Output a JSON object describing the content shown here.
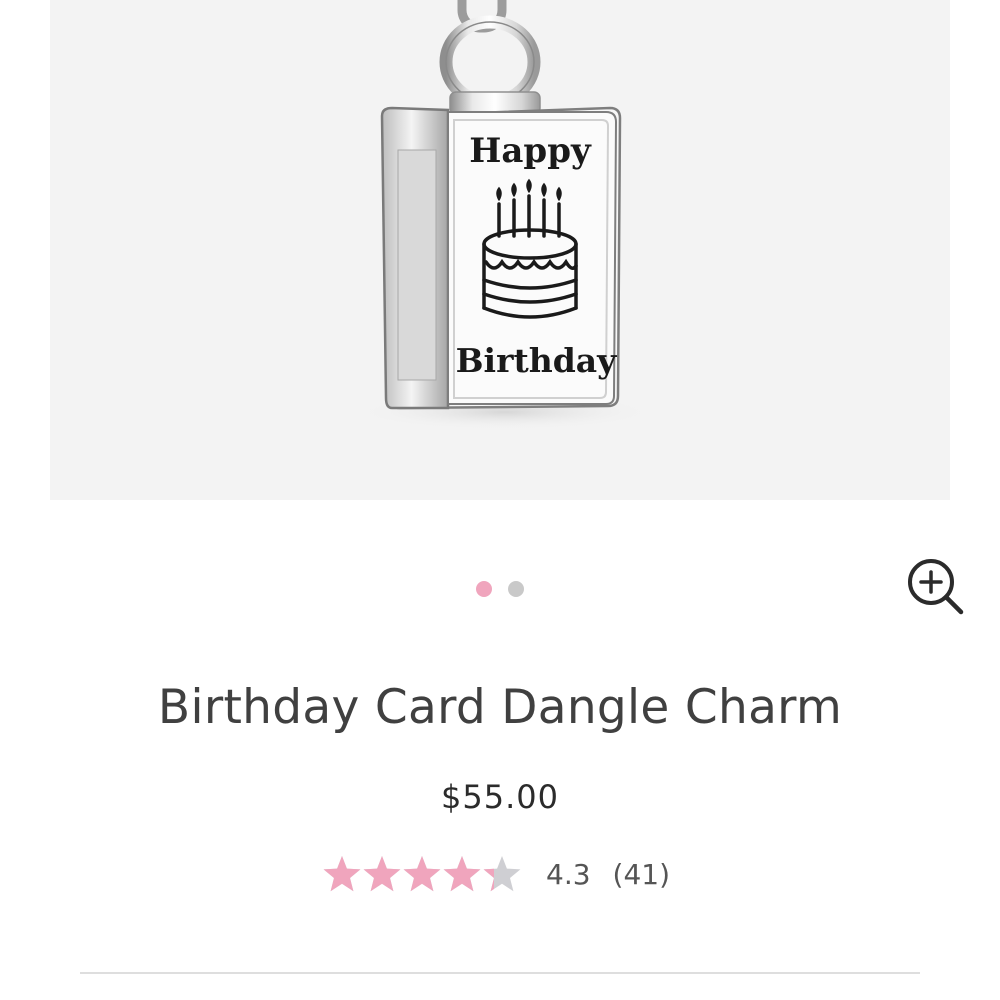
{
  "product": {
    "image": {
      "alt": "Birthday card dangle charm product photo",
      "card_line1": "Happy",
      "card_line2": "Birthday"
    },
    "title": "Birthday Card Dangle Charm",
    "price": "$55.00",
    "rating": {
      "value": "4.3",
      "count": "(41)",
      "stars_filled": 4.3,
      "stars_total": 5
    }
  },
  "carousel": {
    "dots": 2,
    "active_index": 0
  },
  "colors": {
    "accent_pink": "#f0a5bd",
    "dot_inactive": "#c9c9c9",
    "star_empty": "#cfcfd3",
    "image_bg": "#f3f3f3"
  },
  "icons": {
    "zoom": "zoom-in-icon"
  }
}
